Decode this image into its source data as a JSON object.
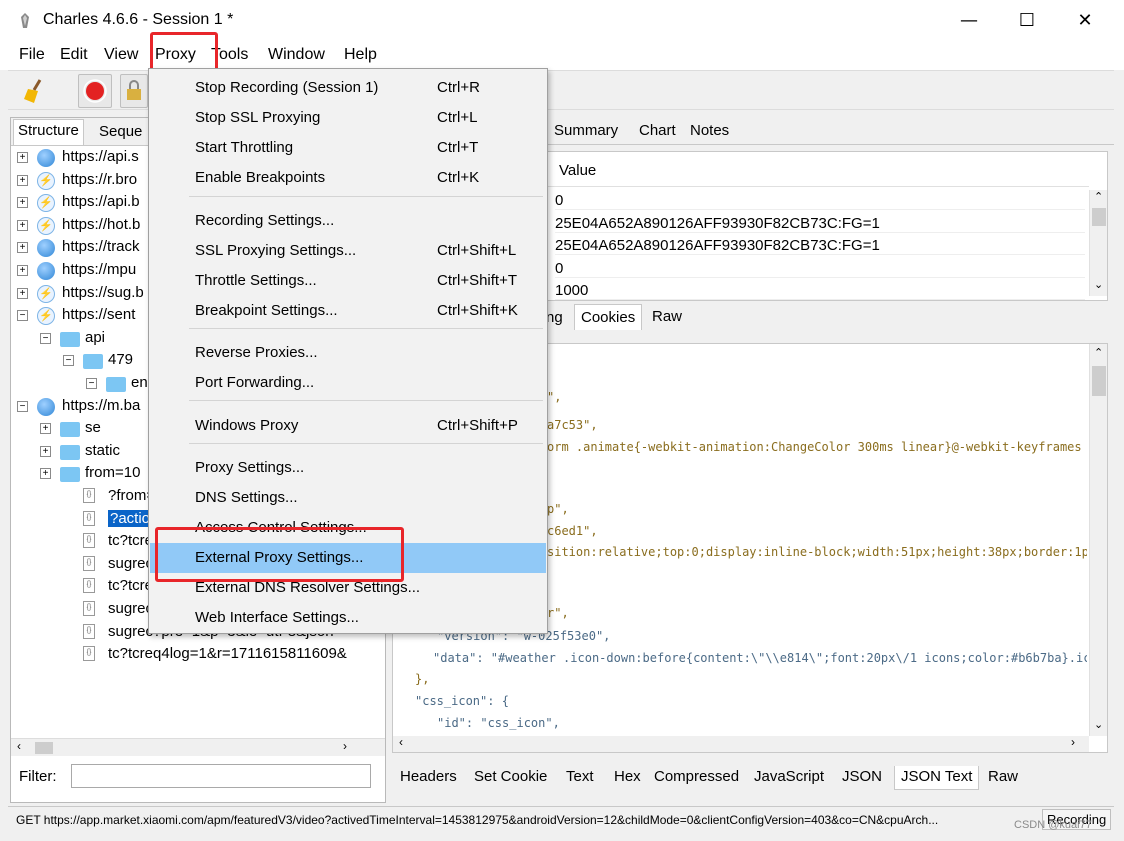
{
  "window": {
    "title": "Charles 4.6.6 - Session 1 *",
    "minimize": "—",
    "maximize": "☐",
    "close": "✕"
  },
  "menubar": [
    "File",
    "Edit",
    "View",
    "Proxy",
    "Tools",
    "Window",
    "Help"
  ],
  "left": {
    "tabs": [
      "Structure",
      "Seque"
    ],
    "rows": [
      {
        "text": "https://api.s",
        "icon": "globe"
      },
      {
        "text": "https://r.bro",
        "icon": "bolt"
      },
      {
        "text": "https://api.b",
        "icon": "bolt"
      },
      {
        "text": "https://hot.b",
        "icon": "bolt"
      },
      {
        "text": "https://track",
        "icon": "globe"
      },
      {
        "text": "https://mpu",
        "icon": "globe"
      },
      {
        "text": "https://sug.b",
        "icon": "bolt"
      },
      {
        "text": "https://sent",
        "icon": "bolt"
      },
      {
        "text": "api",
        "icon": "folder"
      },
      {
        "text": "479",
        "icon": "folder"
      },
      {
        "text": "en",
        "icon": "folder"
      },
      {
        "text": "https://m.ba",
        "icon": "globe"
      },
      {
        "text": "se",
        "icon": "folder"
      },
      {
        "text": "static",
        "icon": "folder"
      },
      {
        "text": "from=10",
        "icon": "folder"
      },
      {
        "text": "?from=1",
        "icon": "doc"
      },
      {
        "text": "?action=",
        "icon": "doc"
      },
      {
        "text": "tc?tcreq4",
        "icon": "doc"
      },
      {
        "text": "sugrec?ty",
        "icon": "doc"
      },
      {
        "text": "tc?tcreq4log=1&r=1711615810190&",
        "icon": "doc"
      },
      {
        "text": "sugrec?pre=1&p=3&ie=utf-8&json=",
        "icon": "doc"
      },
      {
        "text": "sugrec?pre=1&p=3&ie=utf-8&json=",
        "icon": "doc"
      },
      {
        "text": "tc?tcreq4log=1&r=1711615811609&",
        "icon": "doc"
      }
    ],
    "filter_label": "Filter:",
    "filter_value": ""
  },
  "right": {
    "top_tabs": [
      "Summary",
      "Chart",
      "Notes"
    ],
    "table_header": "Value",
    "table_values": [
      "0",
      "25E04A652A890126AFF93930F82CB73C:FG=1",
      "25E04A652A890126AFF93930F82CB73C:FG=1",
      "0",
      "1000"
    ],
    "mid_tabs": [
      "ng",
      "Cookies",
      "Raw"
    ],
    "json_lines": [
      "\",",
      "a7c53\",",
      "orm .animate{-webkit-animation:ChangeColor 300ms linear}@-webkit-keyframes C",
      "p\",",
      "c6ed1\",",
      "sition:relative;top:0;display:inline-block;width:51px;height:38px;border:1px",
      "r\",",
      "\"version\": \"w-025f53e0\",",
      "\"data\": \"#weather .icon-down:before{content:\\\"\\\\e814\\\";font:20px\\/1 icons;color:#b6b7ba}.icon",
      "},",
      "\"css_icon\": {",
      "\"id\": \"css_icon\","
    ],
    "bottom_tabs": [
      "Headers",
      "Set Cookie",
      "Text",
      "Hex",
      "Compressed",
      "JavaScript",
      "JSON",
      "JSON Text",
      "Raw"
    ]
  },
  "status": {
    "url": "GET https://app.market.xiaomi.com/apm/featuredV3/video?activedTimeInterval=1453812975&androidVersion=12&childMode=0&clientConfigVersion=403&co=CN&cpuArch...",
    "recording": "Recording",
    "watermark": "CSDN @kuai77"
  },
  "proxy_menu": {
    "items": [
      {
        "label": "Stop Recording (Session 1)",
        "shortcut": "Ctrl+R"
      },
      {
        "label": "Stop SSL Proxying",
        "shortcut": "Ctrl+L"
      },
      {
        "label": "Start Throttling",
        "shortcut": "Ctrl+T"
      },
      {
        "label": "Enable Breakpoints",
        "shortcut": "Ctrl+K"
      },
      {
        "label": "Recording Settings...",
        "shortcut": ""
      },
      {
        "label": "SSL Proxying Settings...",
        "shortcut": "Ctrl+Shift+L"
      },
      {
        "label": "Throttle Settings...",
        "shortcut": "Ctrl+Shift+T"
      },
      {
        "label": "Breakpoint Settings...",
        "shortcut": "Ctrl+Shift+K"
      },
      {
        "label": "Reverse Proxies...",
        "shortcut": ""
      },
      {
        "label": "Port Forwarding...",
        "shortcut": ""
      },
      {
        "label": "Windows Proxy",
        "shortcut": "Ctrl+Shift+P"
      },
      {
        "label": "Proxy Settings...",
        "shortcut": ""
      },
      {
        "label": "DNS Settings...",
        "shortcut": ""
      },
      {
        "label": "Access Control Settings...",
        "shortcut": ""
      },
      {
        "label": "External Proxy Settings...",
        "shortcut": ""
      },
      {
        "label": "External DNS Resolver Settings...",
        "shortcut": ""
      },
      {
        "label": "Web Interface Settings...",
        "shortcut": ""
      }
    ],
    "highlighted_index": 14
  },
  "colors": {
    "highlight": "#91c9f7",
    "annotation": "#e8262a",
    "selection": "#0a64c8"
  }
}
